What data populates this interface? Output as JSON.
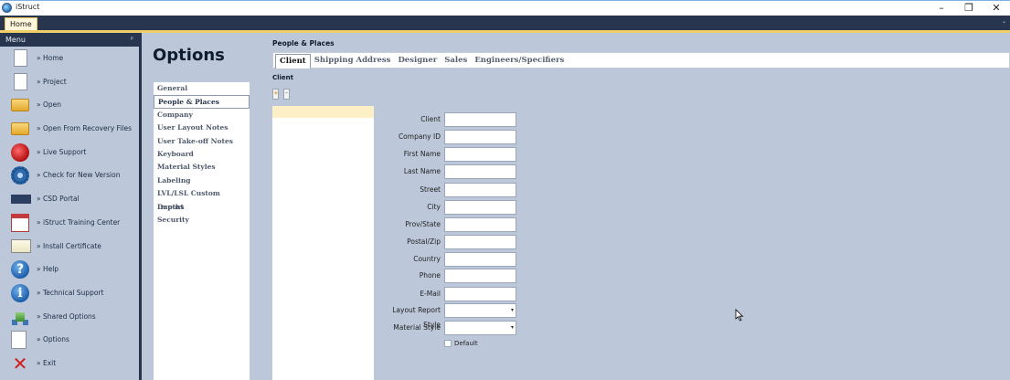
{
  "window": {
    "title": "iStruct",
    "minimize_glyph": "–",
    "restore_glyph": "❐",
    "close_glyph": "✕"
  },
  "ribbon": {
    "tabs": [
      {
        "label": "Home"
      }
    ],
    "collapse_glyph": "⌄"
  },
  "menu": {
    "header": "Menu",
    "pin_glyph": "ᵖ",
    "items": [
      {
        "label": "» Home",
        "icon": "document-icon"
      },
      {
        "label": "» Project",
        "icon": "document-icon"
      },
      {
        "label": "» Open",
        "icon": "folder-icon"
      },
      {
        "label": "» Open From Recovery Files",
        "icon": "folder-icon"
      },
      {
        "label": "» Live Support",
        "icon": "support-icon"
      },
      {
        "label": "» Check for New Version",
        "icon": "gear-icon"
      },
      {
        "label": "» CSD Portal",
        "icon": "csd-logo-icon"
      },
      {
        "label": "» iStruct Training Center",
        "icon": "calendar-icon"
      },
      {
        "label": "» Install Certificate",
        "icon": "certificate-icon"
      },
      {
        "label": "» Help",
        "icon": "help-icon"
      },
      {
        "label": "» Technical Support",
        "icon": "info-icon"
      },
      {
        "label": "» Shared Options",
        "icon": "network-icon"
      },
      {
        "label": "» Options",
        "icon": "options-icon"
      },
      {
        "label": "» Exit",
        "icon": "exit-icon"
      }
    ]
  },
  "options": {
    "title": "Options",
    "categories": [
      "General",
      "People & Places",
      "Company",
      "User Layout Notes",
      "User Take-off Notes",
      "Keyboard",
      "Material Styles",
      "Labeling",
      "LVL/LSL Custom Depths",
      "Import",
      "Security"
    ],
    "active_category": "People & Places"
  },
  "people_places": {
    "section_title": "People & Places",
    "tabs": [
      "Client",
      "Shipping Address",
      "Designer",
      "Sales",
      "Engineers/Specifiers"
    ],
    "active_tab": "Client",
    "sub_title": "Client",
    "add_glyph": "+",
    "remove_glyph": "-",
    "form": {
      "fields": [
        {
          "label": "Client",
          "value": ""
        },
        {
          "label": "Company ID",
          "value": ""
        },
        {
          "label": "First Name",
          "value": ""
        },
        {
          "label": "Last Name",
          "value": ""
        },
        {
          "label": "Street",
          "value": ""
        },
        {
          "label": "City",
          "value": ""
        },
        {
          "label": "Prov/State",
          "value": ""
        },
        {
          "label": "Postal/Zip",
          "value": ""
        },
        {
          "label": "Country",
          "value": ""
        },
        {
          "label": "Phone",
          "value": ""
        }
      ],
      "email": {
        "label": "E-Mail",
        "value": ""
      },
      "layout_report_style": {
        "label": "Layout Report Style",
        "value": ""
      },
      "material_style": {
        "label": "Material Style",
        "value": ""
      },
      "dropdown_glyph": "▾",
      "default_checkbox": {
        "label": "Default",
        "checked": false
      }
    }
  }
}
